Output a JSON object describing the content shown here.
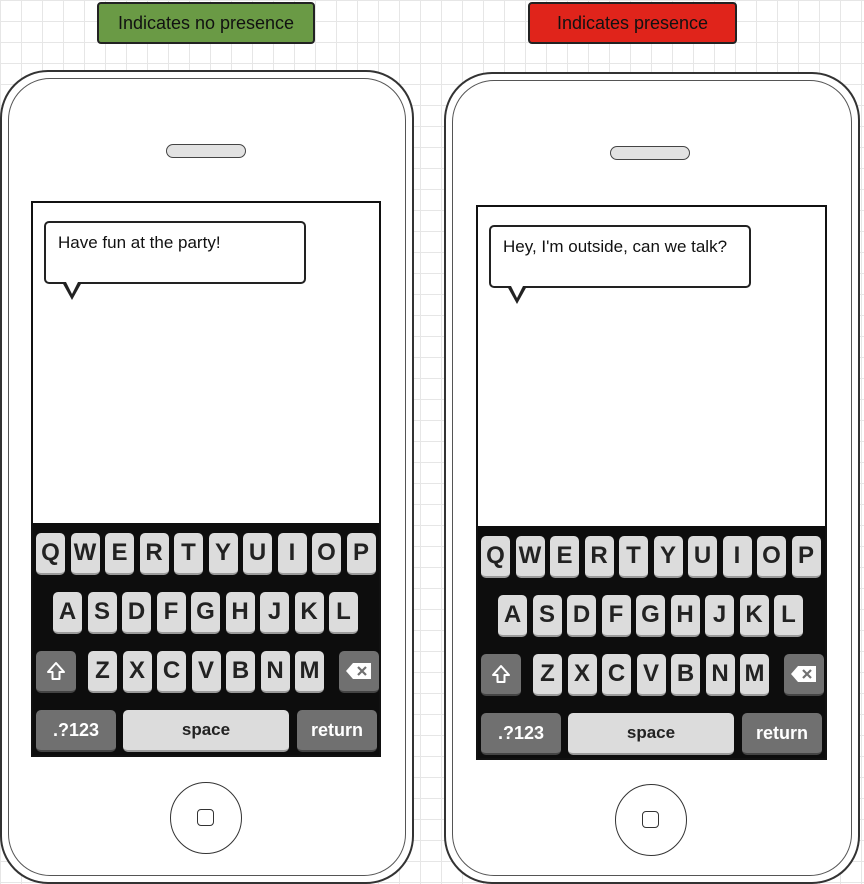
{
  "labels": {
    "left": {
      "text": "Indicates no presence",
      "color": "#6a9a45"
    },
    "right": {
      "text": "Indicates presence",
      "color": "#e0241b"
    }
  },
  "phones": [
    {
      "message": "Have fun at the party!"
    },
    {
      "message": "Hey, I'm outside, can we talk?"
    }
  ],
  "keyboard": {
    "row1": [
      "Q",
      "W",
      "E",
      "R",
      "T",
      "Y",
      "U",
      "I",
      "O",
      "P"
    ],
    "row2": [
      "A",
      "S",
      "D",
      "F",
      "G",
      "H",
      "J",
      "K",
      "L"
    ],
    "row3": [
      "Z",
      "X",
      "C",
      "V",
      "B",
      "N",
      "M"
    ],
    "numbers_label": ".?123",
    "space_label": "space",
    "return_label": "return",
    "shift_icon": "shift-arrow",
    "backspace_icon": "backspace-x"
  }
}
